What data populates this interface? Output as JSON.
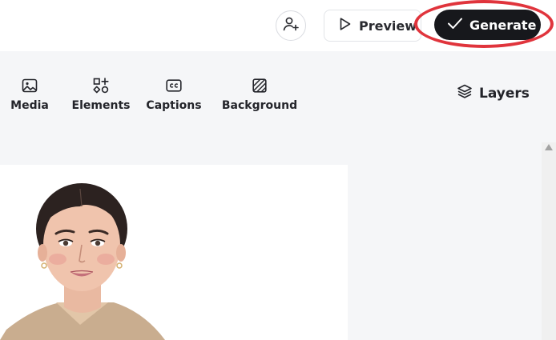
{
  "header": {
    "invite_icon": "add-person-icon",
    "preview_label": "Preview",
    "preview_icon": "play-outline-icon",
    "generate_label": "Generate",
    "generate_icon": "check-icon",
    "highlight_color": "#e0343c",
    "generate_bg": "#17181c"
  },
  "toolbar": {
    "items": [
      {
        "label": "Media",
        "icon": "image-icon"
      },
      {
        "label": "Elements",
        "icon": "shapes-icon"
      },
      {
        "label": "Captions",
        "icon": "cc-icon"
      },
      {
        "label": "Background",
        "icon": "hatched-square-icon"
      }
    ],
    "layers_label": "Layers",
    "layers_icon": "layers-icon"
  },
  "canvas": {
    "background": "#ffffff",
    "content": "avatar-presenter"
  }
}
